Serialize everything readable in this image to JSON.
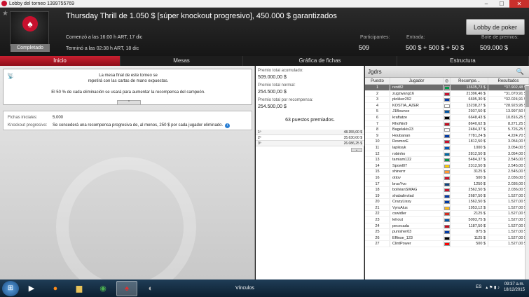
{
  "window": {
    "title": "Lobby del torneo 1399755769"
  },
  "header": {
    "title": "Thursday Thrill de 1.050 $ [súper knockout progresivo], 450.000 $ garantizados",
    "status_badge": "Completado",
    "start": "Comenzó a las 16:00 h ART, 17 dic",
    "end": "Terminó a las 02:38 h ART, 18 dic",
    "lobby_button": "Lobby de poker",
    "participants_label": "Participantes:",
    "participants_value": "509",
    "entry_label": "Entrada:",
    "entry_value": "500 $ + 500 $ + 50 $",
    "prize_pool_label": "Bote de premios:",
    "prize_pool_value": "509.000 $"
  },
  "tabs": [
    {
      "label": "Inicio",
      "active": true
    },
    {
      "label": "Mesas"
    },
    {
      "label": "Gráfica de fichas"
    },
    {
      "label": "Estructura"
    }
  ],
  "left": {
    "notice_line1": "La mesa final de este torneo se",
    "notice_line2": "repetirá con las cartas de mano expuestas.",
    "notice_line3": "El 50 % de cada eliminación se usará para aumentar la recompensa del campeón.",
    "chips_label": "Fichas iniciales:",
    "chips_value": "5.000",
    "knockout_label": "Knockout progresivo:",
    "knockout_value": "Se concederá una recompensa progresiva de, al menos, 250 $ por cada jugador eliminado."
  },
  "prizes": {
    "total_label": "Premio total acumulado:",
    "total_value": "509.000,00 $",
    "normal_label": "Premio total normal:",
    "normal_value": "254.500,00 $",
    "bounty_label": "Premio total por recompensa:",
    "bounty_value": "254.500,00 $",
    "paid_title": "63 puestos premiados.",
    "payouts": [
      {
        "place": "1º",
        "amount": "48.355,00 $"
      },
      {
        "place": "2º",
        "amount": "35.630,00 $"
      },
      {
        "place": "3º",
        "amount": "26.086,25 $"
      }
    ]
  },
  "players": {
    "title": "Jgdrs",
    "columns": [
      "Puesto",
      "Jugador",
      "Recompe...",
      "Resultados"
    ],
    "rows": [
      {
        "pos": "1",
        "name": "rent82",
        "flag": "#009a49",
        "bounty": "13635,73 $",
        "result": "*37.902,48 $"
      },
      {
        "pos": "2",
        "name": "zugzwang16",
        "flag": "#c8102e",
        "bounty": "21396,46 $",
        "result": "*31.070,91 $"
      },
      {
        "pos": "3",
        "name": "plokker292",
        "flag": "#0039a6",
        "bounty": "6695,30 $",
        "result": "*32.024,91 $"
      },
      {
        "pos": "4",
        "name": "KOSTIA_AZER",
        "flag": "#ffffff",
        "bounty": "13238,27 $",
        "result": "*28.923,95 $"
      },
      {
        "pos": "5",
        "name": "J1Bounce",
        "flag": "#0055a4",
        "bounty": "2937,50 $",
        "result": "13.997,50 $"
      },
      {
        "pos": "6",
        "name": "kraftatze",
        "flag": "#000000",
        "bounty": "6648,43 $",
        "result": "10.816,25 $"
      },
      {
        "pos": "7",
        "name": "RhoNin9",
        "flag": "#c60b1e",
        "bounty": "8640,62 $",
        "result": "8.271,25 $"
      },
      {
        "pos": "8",
        "name": "Bagelakis23",
        "flag": "#ffffff",
        "bounty": "2484,37 $",
        "result": "5.726,25 $"
      },
      {
        "pos": "9",
        "name": "Houbanan",
        "flag": "#0039a6",
        "bounty": "7781,24 $",
        "result": "4.224,70 $"
      },
      {
        "pos": "10",
        "name": "RoxmorE",
        "flag": "#c8102e",
        "bounty": "1812,50 $",
        "result": "3.054,00 $"
      },
      {
        "pos": "11",
        "name": "lapiksyk",
        "flag": "#0057b7",
        "bounty": "1000 $",
        "result": "3.054,00 $"
      },
      {
        "pos": "12",
        "name": "robinho",
        "flag": "#006aa7",
        "bounty": "2812,50 $",
        "result": "3.054,00 $"
      },
      {
        "pos": "13",
        "name": "tamiam122",
        "flag": "#009246",
        "bounty": "5484,37 $",
        "result": "2.545,00 $"
      },
      {
        "pos": "14",
        "name": "Spowl07",
        "flag": "#fecb00",
        "bounty": "2312,50 $",
        "result": "2.545,00 $"
      },
      {
        "pos": "15",
        "name": "shinerrr",
        "flag": "#ff9933",
        "bounty": "3125 $",
        "result": "2.545,00 $"
      },
      {
        "pos": "16",
        "name": "ottov",
        "flag": "#c8102e",
        "bounty": "500 $",
        "result": "2.036,00 $"
      },
      {
        "pos": "17",
        "name": "brusYvo",
        "flag": "#11457e",
        "bounty": "1250 $",
        "result": "2.036,00 $"
      },
      {
        "pos": "18",
        "name": "boilvianSWAG",
        "flag": "#c8102e",
        "bounty": "2562,50 $",
        "result": "2.036,00 $"
      },
      {
        "pos": "19",
        "name": "shabalinvlad",
        "flag": "#0039a6",
        "bounty": "2687,50 $",
        "result": "1.527,00 $"
      },
      {
        "pos": "20",
        "name": "CrazyLissy",
        "flag": "#0039a6",
        "bounty": "1562,50 $",
        "result": "1.527,00 $"
      },
      {
        "pos": "21",
        "name": "VyruAlus",
        "flag": "#fdb913",
        "bounty": "1953,12 $",
        "result": "1.527,00 $"
      },
      {
        "pos": "22",
        "name": "cswidler",
        "flag": "#d52b1e",
        "bounty": "2125 $",
        "result": "1.527,00 $"
      },
      {
        "pos": "23",
        "name": "lehout",
        "flag": "#0055a4",
        "bounty": "5093,75 $",
        "result": "1.527,00 $"
      },
      {
        "pos": "24",
        "name": "pececada",
        "flag": "#c60b1e",
        "bounty": "1187,50 $",
        "result": "1.527,00 $"
      },
      {
        "pos": "25",
        "name": "punisher03",
        "flag": "#0039a6",
        "bounty": "875 $",
        "result": "1.527,00 $"
      },
      {
        "pos": "26",
        "name": "Effinse_123",
        "flag": "#000000",
        "bounty": "1125 $",
        "result": "1.527,00 $"
      },
      {
        "pos": "27",
        "name": "ClintPower",
        "flag": "#ff0000",
        "bounty": "500 $",
        "result": "1.527,00 $"
      }
    ]
  },
  "taskbar": {
    "link_label": "Vínculos",
    "lang": "ES",
    "time": "09:37 a.m.",
    "date": "18/12/2015"
  }
}
